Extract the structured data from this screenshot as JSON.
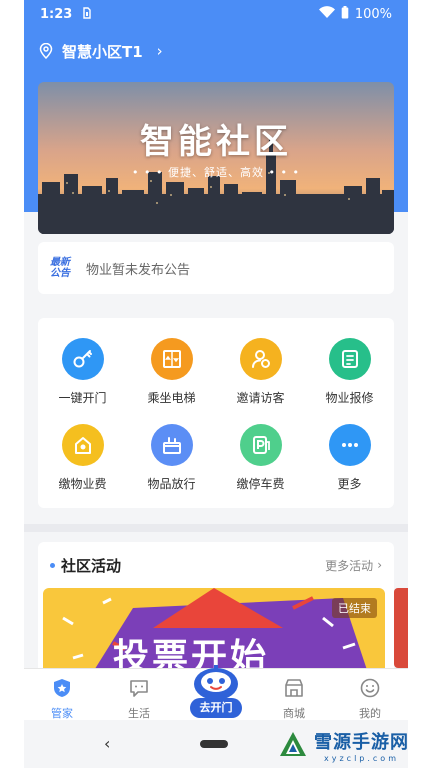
{
  "status_bar": {
    "time": "1:23",
    "battery": "100%"
  },
  "header": {
    "community_name": "智慧小区T1"
  },
  "banner": {
    "title": "智能社区",
    "subtitle": "• • •  便捷、舒适、高效  • • •"
  },
  "notice": {
    "badge_line1": "最新",
    "badge_line2": "公告",
    "text": "物业暂未发布公告"
  },
  "services": [
    {
      "label": "一键开门",
      "icon": "key-icon",
      "color": "#2f97f5"
    },
    {
      "label": "乘坐电梯",
      "icon": "elevator-icon",
      "color": "#f59a1f"
    },
    {
      "label": "邀请访客",
      "icon": "visitor-icon",
      "color": "#f5b21f"
    },
    {
      "label": "物业报修",
      "icon": "repair-icon",
      "color": "#27bf8a"
    },
    {
      "label": "缴物业费",
      "icon": "house-fee-icon",
      "color": "#f5bf1f"
    },
    {
      "label": "物品放行",
      "icon": "package-icon",
      "color": "#5b8ef5"
    },
    {
      "label": "缴停车费",
      "icon": "parking-icon",
      "color": "#4fcf8c"
    },
    {
      "label": "更多",
      "icon": "more-icon",
      "color": "#2f97f5"
    }
  ],
  "activity": {
    "title": "社区活动",
    "more": "更多活动",
    "status": "已结束",
    "poster_title": "投票开始"
  },
  "tabs": [
    {
      "label": "管家",
      "icon": "shield-icon",
      "active": true
    },
    {
      "label": "生活",
      "icon": "chat-icon",
      "active": false
    },
    {
      "label": "去开门",
      "icon": "robot-icon",
      "active": false
    },
    {
      "label": "商城",
      "icon": "store-icon",
      "active": false
    },
    {
      "label": "我的",
      "icon": "smile-icon",
      "active": false
    }
  ],
  "watermark": {
    "main": "雪源手游网",
    "sub": "xyzclp.com"
  },
  "colors": {
    "primary": "#4b8df6",
    "background": "#f4f5f7"
  }
}
